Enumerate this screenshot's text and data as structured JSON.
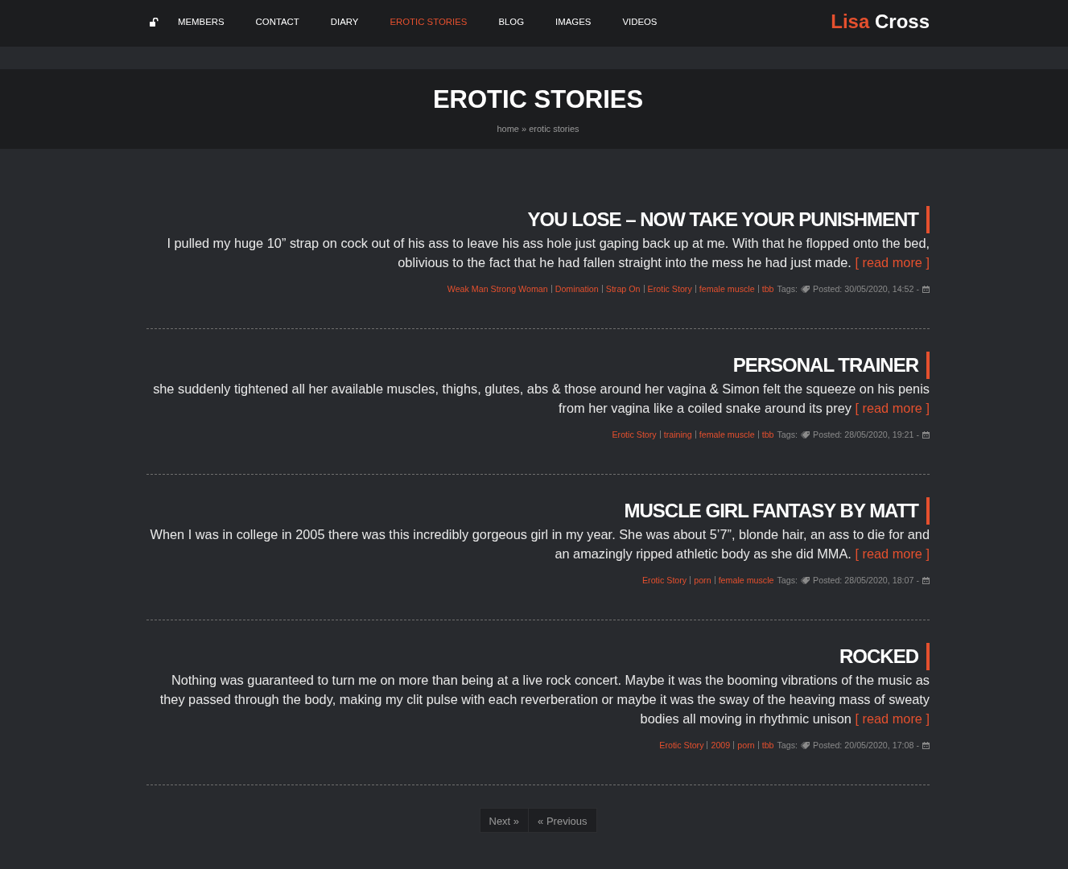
{
  "site": {
    "logo": "**Lisa** Cross"
  },
  "nav": {
    "items": [
      {
        "label": "MEMBERS",
        "selected": false
      },
      {
        "label": "CONTACT",
        "selected": false
      },
      {
        "label": "DIARY",
        "selected": false
      },
      {
        "label": "EROTIC STORIES",
        "selected": true
      },
      {
        "label": "BLOG",
        "selected": false
      },
      {
        "label": "IMAGES",
        "selected": false
      },
      {
        "label": "VIDEOS",
        "selected": false
      }
    ]
  },
  "header": {
    "title": "EROTIC STORIES",
    "breadcrumb": "home » erotic stories"
  },
  "posts": [
    {
      "title": "YOU LOSE – NOW TAKE YOUR PUNISHMENT",
      "excerpt": "I pulled my huge 10” strap on cock out of his ass to leave his ass hole just gaping back up at me. With that he flopped onto the bed, oblivious to the fact that he had fallen straight into the mess he had just made.",
      "read_more": "[ read more ]",
      "tags": [
        "Weak Man Strong Woman",
        "Domination",
        "Strap On",
        "Erotic Story",
        "female muscle",
        "tbb"
      ],
      "tags_label": "Tags:",
      "posted": "Posted: 30/05/2020, 14:52 -"
    },
    {
      "title": "PERSONAL TRAINER",
      "excerpt": "she suddenly tightened all her available muscles, thighs, glutes, abs & those around her vagina & Simon felt the squeeze on his penis from her vagina like a coiled snake around its prey",
      "read_more": "[ read more ]",
      "tags": [
        "Erotic Story",
        "training",
        "female muscle",
        "tbb"
      ],
      "tags_label": "Tags:",
      "posted": "Posted: 28/05/2020, 19:21 -"
    },
    {
      "title": "MUSCLE GIRL FANTASY BY MATT",
      "excerpt": "When I was in college in 2005 there was this incredibly gorgeous girl in my year. She was about 5’7”, blonde hair, an ass to die for and an amazingly ripped athletic body as she did MMA.",
      "read_more": "[ read more ]",
      "tags": [
        "Erotic Story",
        "porn",
        "female muscle"
      ],
      "tags_label": "Tags:",
      "posted": "Posted: 28/05/2020, 18:07 -"
    },
    {
      "title": "ROCKED",
      "excerpt": "Nothing was guaranteed to turn me on more than being at a live rock concert. Maybe it was the booming vibrations of the music as they passed through the body, making my clit pulse with each reverberation or maybe it was the sway of the heaving mass of sweaty bodies all moving in rhythmic unison",
      "read_more": "[ read more ]",
      "tags": [
        "Erotic Story",
        "2009",
        "porn",
        "tbb"
      ],
      "tags_label": "Tags:",
      "posted": "Posted: 20/05/2020, 17:08 -"
    }
  ],
  "pagination": {
    "next": "Next »",
    "previous": "« Previous"
  }
}
